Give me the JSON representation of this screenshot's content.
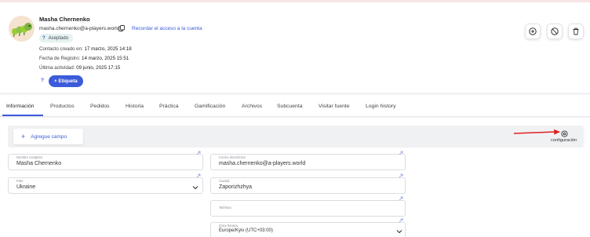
{
  "profile": {
    "name": "Masha Chernenko",
    "email": "masha.chernenko@a-players.world",
    "recover_link": "Recordar el acceso a la cuenta",
    "status": {
      "mark": "?",
      "label": "Aceptado"
    },
    "created": {
      "label": "Contacto creado en:",
      "value": "17 marzo, 2025 14:18"
    },
    "registered": {
      "label": "Fecha de Registro:",
      "value": "14 marzo, 2025 15:51"
    },
    "last_activity": {
      "label": "Última actividad:",
      "value": "09 junio, 2025 17:15"
    },
    "help_mark": "?",
    "tag_button": "+ Etiqueta"
  },
  "actions": [
    "add-circle-icon",
    "block-icon",
    "trash-icon"
  ],
  "tabs": [
    {
      "label": "Información",
      "active": true
    },
    {
      "label": "Productos"
    },
    {
      "label": "Pedidos"
    },
    {
      "label": "Historia"
    },
    {
      "label": "Práctica"
    },
    {
      "label": "Gamificación"
    },
    {
      "label": "Archivos"
    },
    {
      "label": "Subcuenta"
    },
    {
      "label": "Visitar fuente"
    },
    {
      "label": "Login history"
    }
  ],
  "toolbar": {
    "add_field_plus": "+",
    "add_field_label": "Agregue campo",
    "config_label": "configuración"
  },
  "fields": {
    "full_name": {
      "label": "Nombre completo",
      "value": "Masha Chernenko"
    },
    "email": {
      "label": "Correo electrónico",
      "value": "masha.chernenko@a-players.world"
    },
    "country": {
      "label": "País",
      "value": "Ukraine"
    },
    "city": {
      "label": "Ciudad",
      "value": "Zaporizhzhya"
    },
    "phone": {
      "label": "Teléfono",
      "value": ""
    },
    "timezone": {
      "label": "Zona horaria",
      "value": "Europe/Kyiv (UTC+03:00)"
    }
  },
  "colors": {
    "accent": "#3b5bdb",
    "arrow": "#e02020",
    "badge_bg": "#e5f2ef"
  }
}
